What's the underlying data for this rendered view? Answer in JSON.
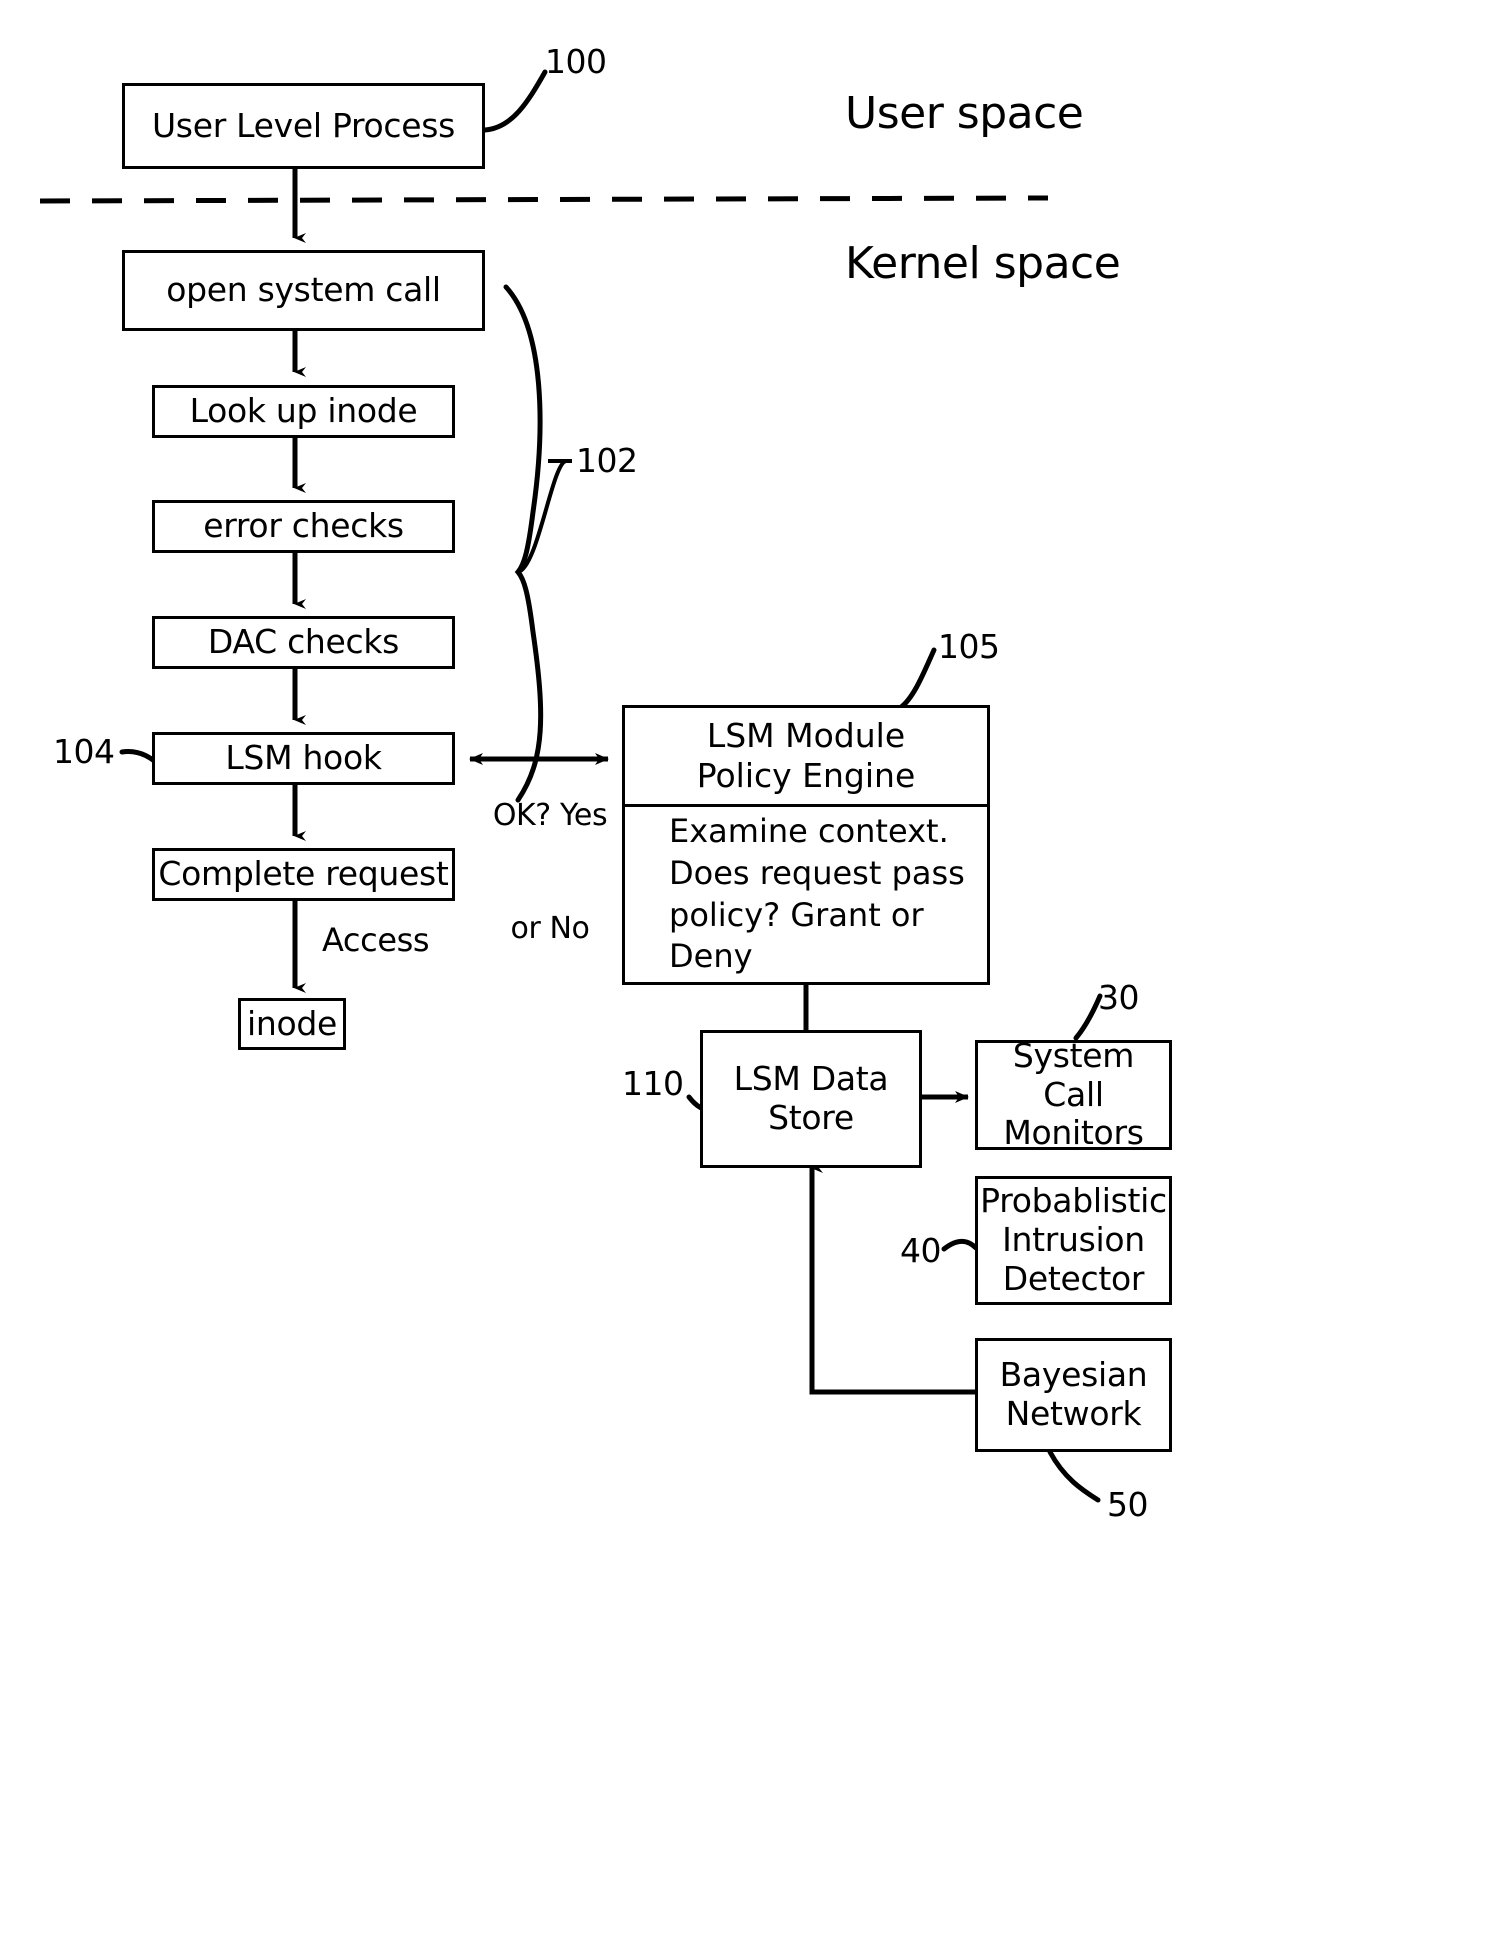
{
  "diagram": {
    "title_region": "LSM hook security flow diagram",
    "space_labels": {
      "user_space": "User space",
      "kernel_space": "Kernel space"
    },
    "reference_numerals": {
      "n100": "100",
      "n102": "102",
      "n104": "104",
      "n105": "105",
      "n110": "110",
      "n30": "30",
      "n40": "40",
      "n50": "50"
    },
    "nodes": {
      "user_level_process": "User Level Process",
      "open_system_call": "open system call",
      "look_up_inode": "Look up inode",
      "error_checks": "error checks",
      "dac_checks": "DAC checks",
      "lsm_hook": "LSM hook",
      "complete_request": "Complete request",
      "inode": "inode",
      "lsm_module_line1": "LSM Module",
      "lsm_module_line2": "Policy Engine",
      "lsm_module_body_line1": "Examine context.",
      "lsm_module_body_line2": "Does request pass",
      "lsm_module_body_line3": "policy? Grant or Deny",
      "lsm_data_store_line1": "LSM Data",
      "lsm_data_store_line2": "Store",
      "system_call_monitors_line1": "System Call",
      "system_call_monitors_line2": "Monitors",
      "probabilistic_detector_line1": "Probablistic",
      "probabilistic_detector_line2": "Intrusion",
      "probabilistic_detector_line3": "Detector",
      "bayesian_network_line1": "Bayesian",
      "bayesian_network_line2": "Network"
    },
    "edge_labels": {
      "ok_yes_line1": "OK? Yes",
      "ok_no_line2": "or No",
      "access": "Access"
    },
    "colors": {
      "stroke": "#000000",
      "background": "#ffffff"
    }
  }
}
